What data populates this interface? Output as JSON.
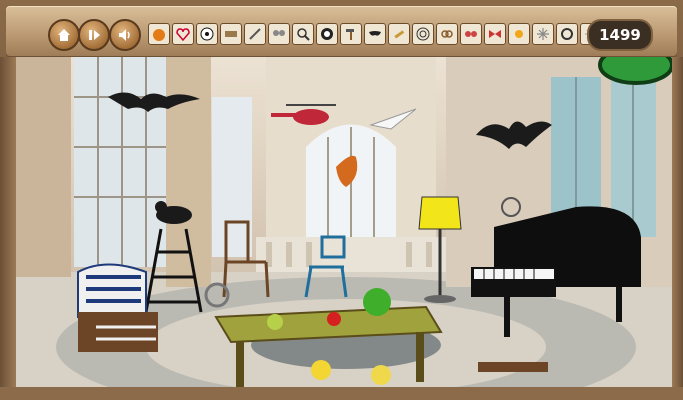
{
  "hud": {
    "score": "1499",
    "controls": [
      {
        "name": "home-icon"
      },
      {
        "name": "pause-play-icon"
      },
      {
        "name": "sound-icon"
      }
    ],
    "find_items": [
      "pumpkin-icon",
      "heart-icon",
      "soccer-ball-icon",
      "wooden-board-icon",
      "feather-icon",
      "butterfly-icon",
      "magnifier-icon",
      "dartboard-icon",
      "hammer-icon",
      "mask-icon",
      "pencil-icon",
      "target-icon",
      "pretzel-icon",
      "butterfly-2-icon",
      "bow-icon",
      "sun-icon",
      "snowflake-icon",
      "ring-icon",
      "snowflake-2-icon",
      "eight-ball-icon"
    ]
  }
}
